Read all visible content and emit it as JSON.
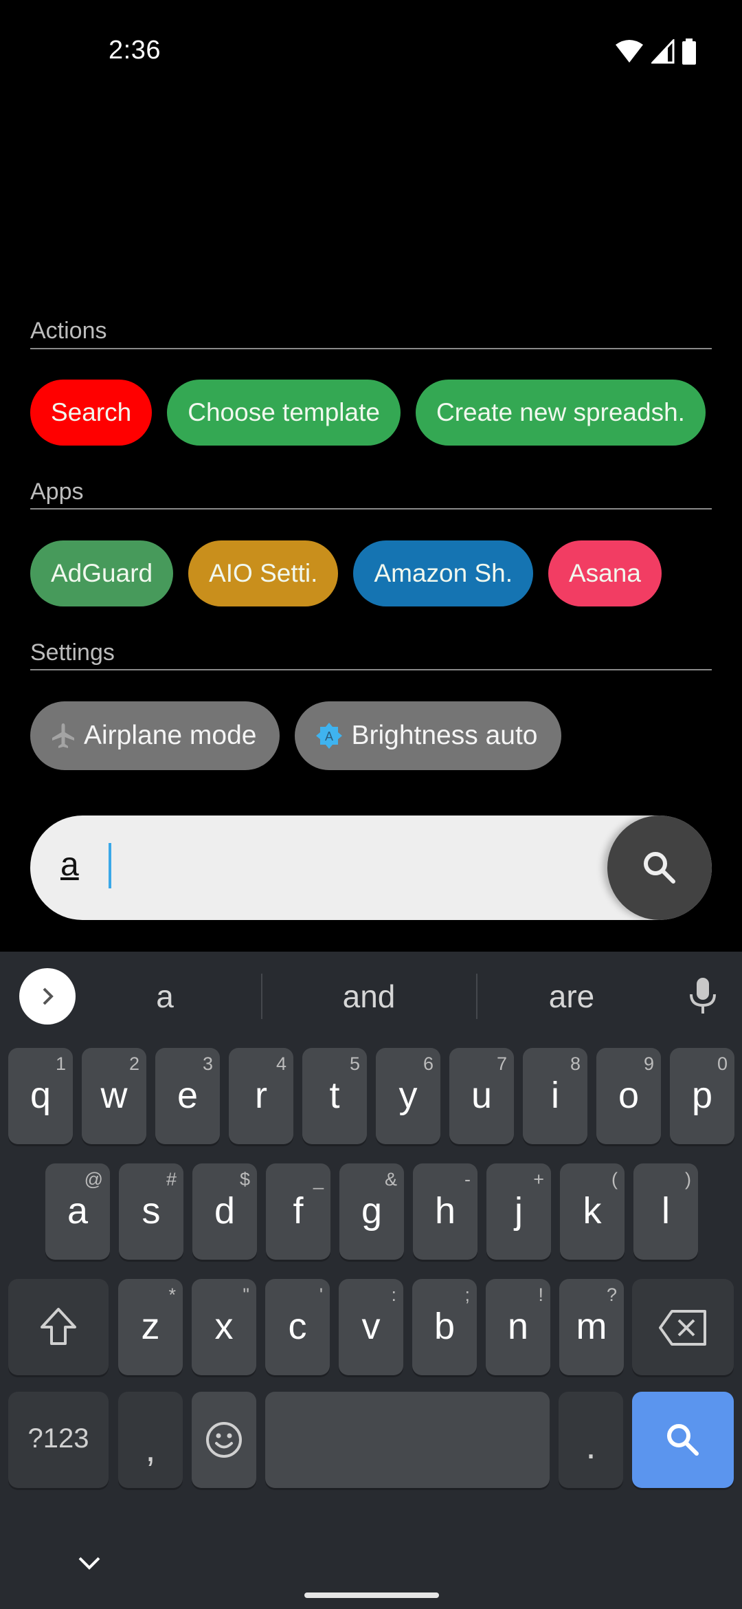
{
  "status_bar": {
    "time": "2:36",
    "icons": [
      "wifi-icon",
      "cell-signal-icon",
      "battery-icon"
    ]
  },
  "sections": {
    "actions": {
      "label": "Actions",
      "chips": [
        {
          "label": "Search",
          "color": "#ff0000"
        },
        {
          "label": "Choose template",
          "color": "#34a853"
        },
        {
          "label": "Create new spreadsh.",
          "color": "#34a853"
        }
      ]
    },
    "apps": {
      "label": "Apps",
      "chips": [
        {
          "label": "AdGuard",
          "color": "#479a5b"
        },
        {
          "label": "AIO Setti.",
          "color": "#c98f1c"
        },
        {
          "label": "Amazon Sh.",
          "color": "#1574b2"
        },
        {
          "label": "Asana",
          "color": "#f23d63"
        }
      ]
    },
    "settings": {
      "label": "Settings",
      "chips": [
        {
          "label": "Airplane mode",
          "icon": "airplane-icon"
        },
        {
          "label": "Brightness auto",
          "icon": "brightness-auto-icon"
        }
      ]
    }
  },
  "search": {
    "value": "a",
    "button_icon": "search-icon"
  },
  "keyboard": {
    "suggestions": [
      "a",
      "and",
      "are"
    ],
    "row1": [
      {
        "key": "q",
        "hint": "1"
      },
      {
        "key": "w",
        "hint": "2"
      },
      {
        "key": "e",
        "hint": "3"
      },
      {
        "key": "r",
        "hint": "4"
      },
      {
        "key": "t",
        "hint": "5"
      },
      {
        "key": "y",
        "hint": "6"
      },
      {
        "key": "u",
        "hint": "7"
      },
      {
        "key": "i",
        "hint": "8"
      },
      {
        "key": "o",
        "hint": "9"
      },
      {
        "key": "p",
        "hint": "0"
      }
    ],
    "row2": [
      {
        "key": "a",
        "hint": "@"
      },
      {
        "key": "s",
        "hint": "#"
      },
      {
        "key": "d",
        "hint": "$"
      },
      {
        "key": "f",
        "hint": "_"
      },
      {
        "key": "g",
        "hint": "&"
      },
      {
        "key": "h",
        "hint": "-"
      },
      {
        "key": "j",
        "hint": "+"
      },
      {
        "key": "k",
        "hint": "("
      },
      {
        "key": "l",
        "hint": ")"
      }
    ],
    "row3": [
      {
        "key": "z",
        "hint": "*"
      },
      {
        "key": "x",
        "hint": "\""
      },
      {
        "key": "c",
        "hint": "'"
      },
      {
        "key": "v",
        "hint": ":"
      },
      {
        "key": "b",
        "hint": ";"
      },
      {
        "key": "n",
        "hint": "!"
      },
      {
        "key": "m",
        "hint": "?"
      }
    ],
    "symbols_label": "?123",
    "comma": ",",
    "period": ".",
    "action_color": "#5b95ee"
  }
}
